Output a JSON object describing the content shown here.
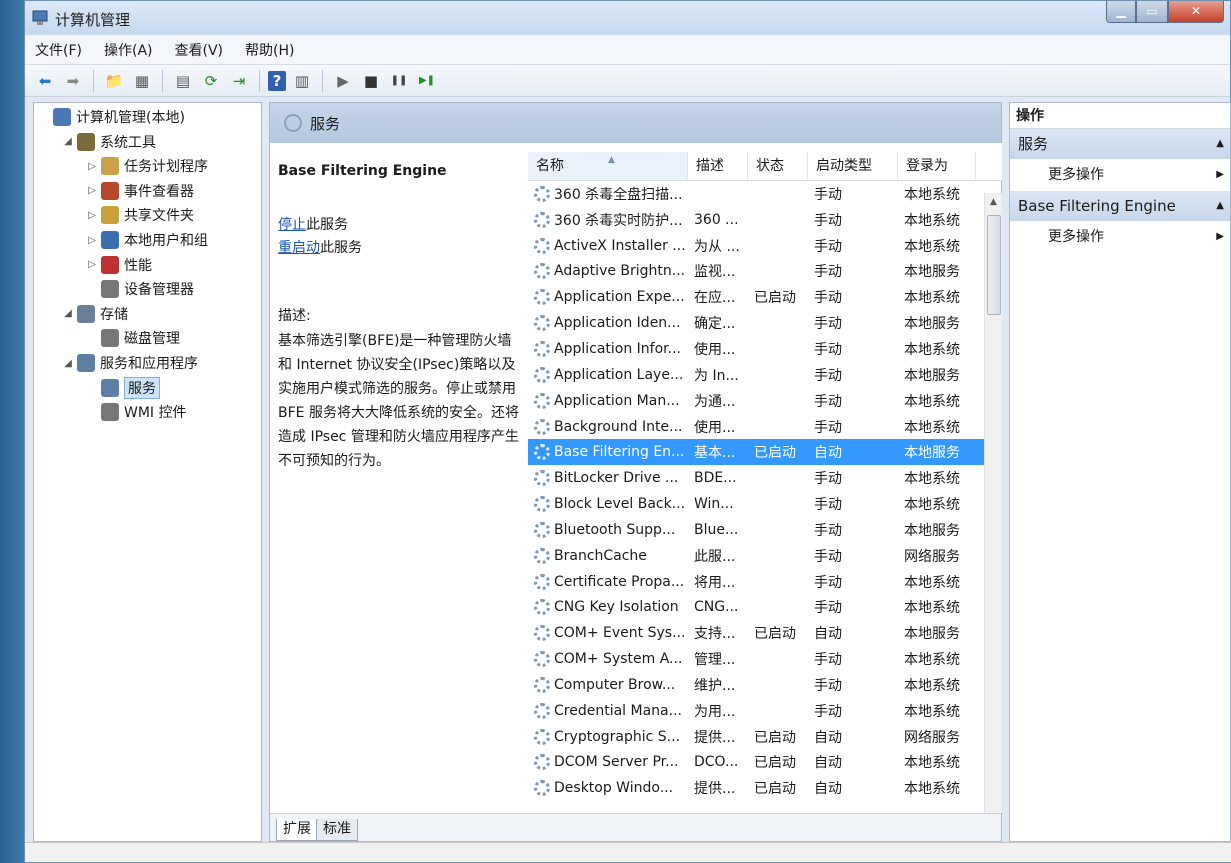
{
  "window": {
    "title": "计算机管理"
  },
  "menu": [
    "文件(F)",
    "操作(A)",
    "查看(V)",
    "帮助(H)"
  ],
  "toolbar": [
    "back-icon",
    "forward-icon",
    "up-folder-icon",
    "show-hide-tree-icon",
    "properties-icon",
    "refresh-icon",
    "export-icon",
    "help-icon",
    "show-hide-action-icon",
    "start-service-icon",
    "stop-service-icon",
    "pause-service-icon",
    "restart-service-icon"
  ],
  "tree": [
    {
      "label": "计算机管理(本地)",
      "depth": 0,
      "arrow": "",
      "icon": "computer-icon"
    },
    {
      "label": "系统工具",
      "depth": 1,
      "arrow": "◢",
      "icon": "tools-icon"
    },
    {
      "label": "任务计划程序",
      "depth": 2,
      "arrow": "▷",
      "icon": "clock-icon"
    },
    {
      "label": "事件查看器",
      "depth": 2,
      "arrow": "▷",
      "icon": "event-viewer-icon"
    },
    {
      "label": "共享文件夹",
      "depth": 2,
      "arrow": "▷",
      "icon": "shared-folder-icon"
    },
    {
      "label": "本地用户和组",
      "depth": 2,
      "arrow": "▷",
      "icon": "users-icon"
    },
    {
      "label": "性能",
      "depth": 2,
      "arrow": "▷",
      "icon": "performance-icon"
    },
    {
      "label": "设备管理器",
      "depth": 2,
      "arrow": "",
      "icon": "device-manager-icon"
    },
    {
      "label": "存储",
      "depth": 1,
      "arrow": "◢",
      "icon": "storage-icon"
    },
    {
      "label": "磁盘管理",
      "depth": 2,
      "arrow": "",
      "icon": "disk-icon"
    },
    {
      "label": "服务和应用程序",
      "depth": 1,
      "arrow": "◢",
      "icon": "services-apps-icon"
    },
    {
      "label": "服务",
      "depth": 2,
      "arrow": "",
      "icon": "services-gear-icon",
      "selected": true
    },
    {
      "label": "WMI 控件",
      "depth": 2,
      "arrow": "",
      "icon": "wmi-icon"
    }
  ],
  "center": {
    "header": "服务",
    "desc_title": "Base Filtering Engine",
    "stop_link": "停止",
    "stop_suffix": "此服务",
    "restart_link": "重启动",
    "restart_suffix": "此服务",
    "desc_label": "描述:",
    "desc_text": "基本筛选引擎(BFE)是一种管理防火墙和 Internet 协议安全(IPsec)策略以及实施用户模式筛选的服务。停止或禁用 BFE 服务将大大降低系统的安全。还将造成 IPsec 管理和防火墙应用程序产生不可预知的行为。"
  },
  "columns": [
    "名称",
    "描述",
    "状态",
    "启动类型",
    "登录为"
  ],
  "services": [
    [
      "360 杀毒全盘扫描...",
      "",
      "",
      "手动",
      "本地系统"
    ],
    [
      "360 杀毒实时防护...",
      "360 ...",
      "",
      "手动",
      "本地系统"
    ],
    [
      "ActiveX Installer ...",
      "为从 ...",
      "",
      "手动",
      "本地系统"
    ],
    [
      "Adaptive Brightn...",
      "监视...",
      "",
      "手动",
      "本地服务"
    ],
    [
      "Application Expe...",
      "在应...",
      "已启动",
      "手动",
      "本地系统"
    ],
    [
      "Application Iden...",
      "确定...",
      "",
      "手动",
      "本地服务"
    ],
    [
      "Application Infor...",
      "使用...",
      "",
      "手动",
      "本地系统"
    ],
    [
      "Application Laye...",
      "为 In...",
      "",
      "手动",
      "本地服务"
    ],
    [
      "Application Man...",
      "为通...",
      "",
      "手动",
      "本地系统"
    ],
    [
      "Background Inte...",
      "使用...",
      "",
      "手动",
      "本地系统"
    ],
    [
      "Base Filtering En...",
      "基本...",
      "已启动",
      "自动",
      "本地服务"
    ],
    [
      "BitLocker Drive ...",
      "BDE...",
      "",
      "手动",
      "本地系统"
    ],
    [
      "Block Level Back...",
      "Win...",
      "",
      "手动",
      "本地系统"
    ],
    [
      "Bluetooth Supp...",
      "Blue...",
      "",
      "手动",
      "本地服务"
    ],
    [
      "BranchCache",
      "此服...",
      "",
      "手动",
      "网络服务"
    ],
    [
      "Certificate Propa...",
      "将用...",
      "",
      "手动",
      "本地系统"
    ],
    [
      "CNG Key Isolation",
      "CNG...",
      "",
      "手动",
      "本地系统"
    ],
    [
      "COM+ Event Sys...",
      "支持...",
      "已启动",
      "自动",
      "本地服务"
    ],
    [
      "COM+ System A...",
      "管理...",
      "",
      "手动",
      "本地系统"
    ],
    [
      "Computer Brow...",
      "维护...",
      "",
      "手动",
      "本地系统"
    ],
    [
      "Credential Mana...",
      "为用...",
      "",
      "手动",
      "本地系统"
    ],
    [
      "Cryptographic S...",
      "提供...",
      "已启动",
      "自动",
      "网络服务"
    ],
    [
      "DCOM Server Pr...",
      "DCO...",
      "已启动",
      "自动",
      "本地系统"
    ],
    [
      "Desktop Windo...",
      "提供...",
      "已启动",
      "自动",
      "本地系统"
    ]
  ],
  "selected_index": 10,
  "tabs": [
    "扩展",
    "标准"
  ],
  "actions": {
    "title": "操作",
    "sections": [
      {
        "label": "服务",
        "items": [
          "更多操作"
        ]
      },
      {
        "label": "Base Filtering Engine",
        "items": [
          "更多操作"
        ]
      }
    ]
  }
}
